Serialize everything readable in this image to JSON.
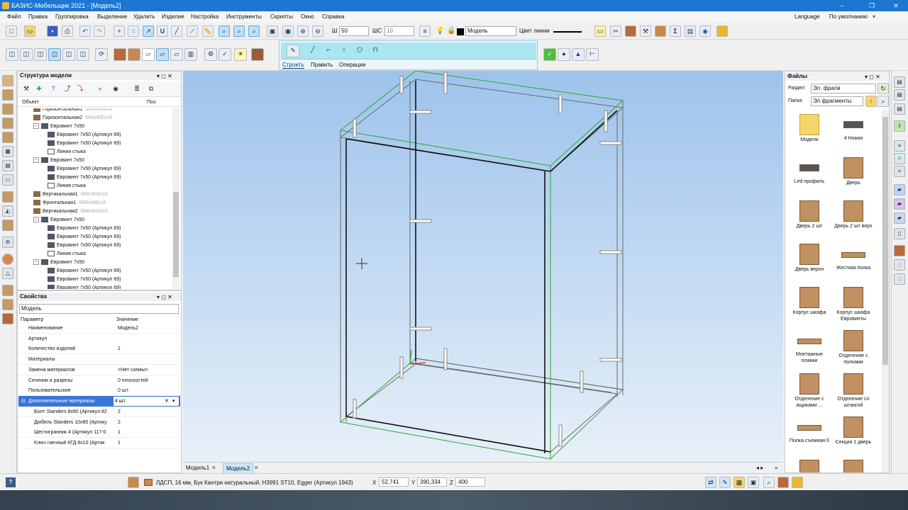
{
  "window": {
    "title": "БАЗИС-Мебельщик 2021 - [Модель2]",
    "controls": [
      "–",
      "❐",
      "✕"
    ]
  },
  "menu": [
    "Файл",
    "Правка",
    "Группировка",
    "Выделение",
    "Удалить",
    "Изделие",
    "Настройка",
    "Инструменты",
    "Скрипты",
    "Окно",
    "Справка"
  ],
  "menu_right": {
    "language": "Language",
    "default": "По умолчанию"
  },
  "toolbar": {
    "w_label": "Ш",
    "w_value": "50",
    "shs_label": "ШС",
    "shs_value": "10",
    "layer_value": "Модель",
    "line_color_label": "Цвет линии"
  },
  "build_panel": {
    "tabs": [
      "Строить",
      "Править",
      "Операции"
    ]
  },
  "structure": {
    "title": "Структура модели",
    "col_object": "Объект",
    "col_pos": "Поз.",
    "rows": [
      {
        "label": "Горизонтальная1",
        "dim": "500x400x16",
        "level": 1,
        "icon": "panel",
        "expand": ""
      },
      {
        "label": "Горизонтальная2",
        "dim": "500x400x16",
        "level": 1,
        "icon": "panel",
        "expand": ""
      },
      {
        "label": "Евровинт 7x50",
        "dim": "",
        "level": 1,
        "icon": "group",
        "expand": "−"
      },
      {
        "label": "Евровинт 7x50 (Артикул 69)",
        "dim": "",
        "level": 2,
        "icon": "screw",
        "expand": ""
      },
      {
        "label": "Евровинт 7x50 (Артикул 69)",
        "dim": "",
        "level": 2,
        "icon": "screw",
        "expand": ""
      },
      {
        "label": "Линия стыка",
        "dim": "",
        "level": 2,
        "icon": "line",
        "expand": ""
      },
      {
        "label": "Евровинт 7x50",
        "dim": "",
        "level": 1,
        "icon": "group",
        "expand": "−"
      },
      {
        "label": "Евровинт 7x50 (Артикул 69)",
        "dim": "",
        "level": 2,
        "icon": "screw",
        "expand": ""
      },
      {
        "label": "Евровинт 7x50 (Артикул 69)",
        "dim": "",
        "level": 2,
        "icon": "screw",
        "expand": ""
      },
      {
        "label": "Линия стыка",
        "dim": "",
        "level": 2,
        "icon": "line",
        "expand": ""
      },
      {
        "label": "Вертикальная1",
        "dim": "668x400x16",
        "level": 1,
        "icon": "panel",
        "expand": ""
      },
      {
        "label": "Фронтальная1",
        "dim": "668x468x16",
        "level": 1,
        "icon": "panel",
        "expand": ""
      },
      {
        "label": "Вертикальная2",
        "dim": "668x400x16",
        "level": 1,
        "icon": "panel",
        "expand": ""
      },
      {
        "label": "Евровинт 7x50",
        "dim": "",
        "level": 1,
        "icon": "group",
        "expand": "−"
      },
      {
        "label": "Евровинт 7x50 (Артикул 69)",
        "dim": "",
        "level": 2,
        "icon": "screw",
        "expand": ""
      },
      {
        "label": "Евровинт 7x50 (Артикул 69)",
        "dim": "",
        "level": 2,
        "icon": "screw",
        "expand": ""
      },
      {
        "label": "Евровинт 7x50 (Артикул 69)",
        "dim": "",
        "level": 2,
        "icon": "screw",
        "expand": ""
      },
      {
        "label": "Линия стыка",
        "dim": "",
        "level": 2,
        "icon": "line",
        "expand": ""
      },
      {
        "label": "Евровинт 7x50",
        "dim": "",
        "level": 1,
        "icon": "group",
        "expand": "−"
      },
      {
        "label": "Евровинт 7x50 (Артикул 69)",
        "dim": "",
        "level": 2,
        "icon": "screw",
        "expand": ""
      },
      {
        "label": "Евровинт 7x50 (Артикул 69)",
        "dim": "",
        "level": 2,
        "icon": "screw",
        "expand": ""
      },
      {
        "label": "Евровинт 7x50 (Артикул 69)",
        "dim": "",
        "level": 2,
        "icon": "screw",
        "expand": ""
      }
    ]
  },
  "properties": {
    "title": "Свойства",
    "selector": "Модель",
    "col_param": "Параметр",
    "col_value": "Значение",
    "rows": [
      {
        "name": "Наименование",
        "value": "Модель2"
      },
      {
        "name": "Артикул",
        "value": ""
      },
      {
        "name": "Количество изделий",
        "value": "1"
      },
      {
        "name": "Материалы",
        "value": ""
      },
      {
        "name": "Замена материалов",
        "value": "<Нет схемы>"
      },
      {
        "name": "Сечения и разрезы",
        "value": "0 плоскостей"
      },
      {
        "name": "Пользовательские",
        "value": "0 шт."
      }
    ],
    "extra": {
      "name": "Дополнительные материалы",
      "value": "4 шт."
    },
    "sub_rows": [
      {
        "name": "Болт Standers 8x80 (Артикул 82",
        "value": "2"
      },
      {
        "name": "Дюбель Standers 10x80 (Артику",
        "value": "2"
      },
      {
        "name": "Шестигранник 4 (Артикул 117-0",
        "value": "1"
      },
      {
        "name": "Ключ гаечный КГД 8x10 (Артик",
        "value": "1"
      }
    ]
  },
  "files": {
    "title": "Файлы",
    "section_label": "Раздел",
    "section_value": "Эл. фрагм",
    "folder_label": "Папка",
    "folder_value": "Эл фрагменты",
    "items": [
      "Модели",
      "4 Ножки",
      "Led профиль",
      "Дверь",
      "Дверь 2 шт",
      "Дверь 2 шт верх",
      "Дверь верхн",
      "Жесткая полка",
      "Корпус шкафа",
      "Корпус шкафа Евровинты",
      "Монтажные планки",
      "Отделение с полками",
      "Отделение с ящиками ...",
      "Отделение со штангой",
      "Полка съемная 0",
      "Секция 1 дверь",
      "",
      ""
    ]
  },
  "tabs": [
    "Модель1",
    "Модель2"
  ],
  "status": {
    "help": "?",
    "material": "ЛДСП, 16 мм, Бук Кантри натуральный, Н3991 ST10, Egger (Артикул 1943)",
    "x_label": "X",
    "x": "52,741",
    "y_label": "Y",
    "y": "390,334",
    "z_label": "Z",
    "z": "400"
  },
  "colors": {
    "accent": "#1c76d2",
    "viewport_top": "#9ec3ec",
    "edge_green": "#2aa82a",
    "wood": "#c09060"
  }
}
